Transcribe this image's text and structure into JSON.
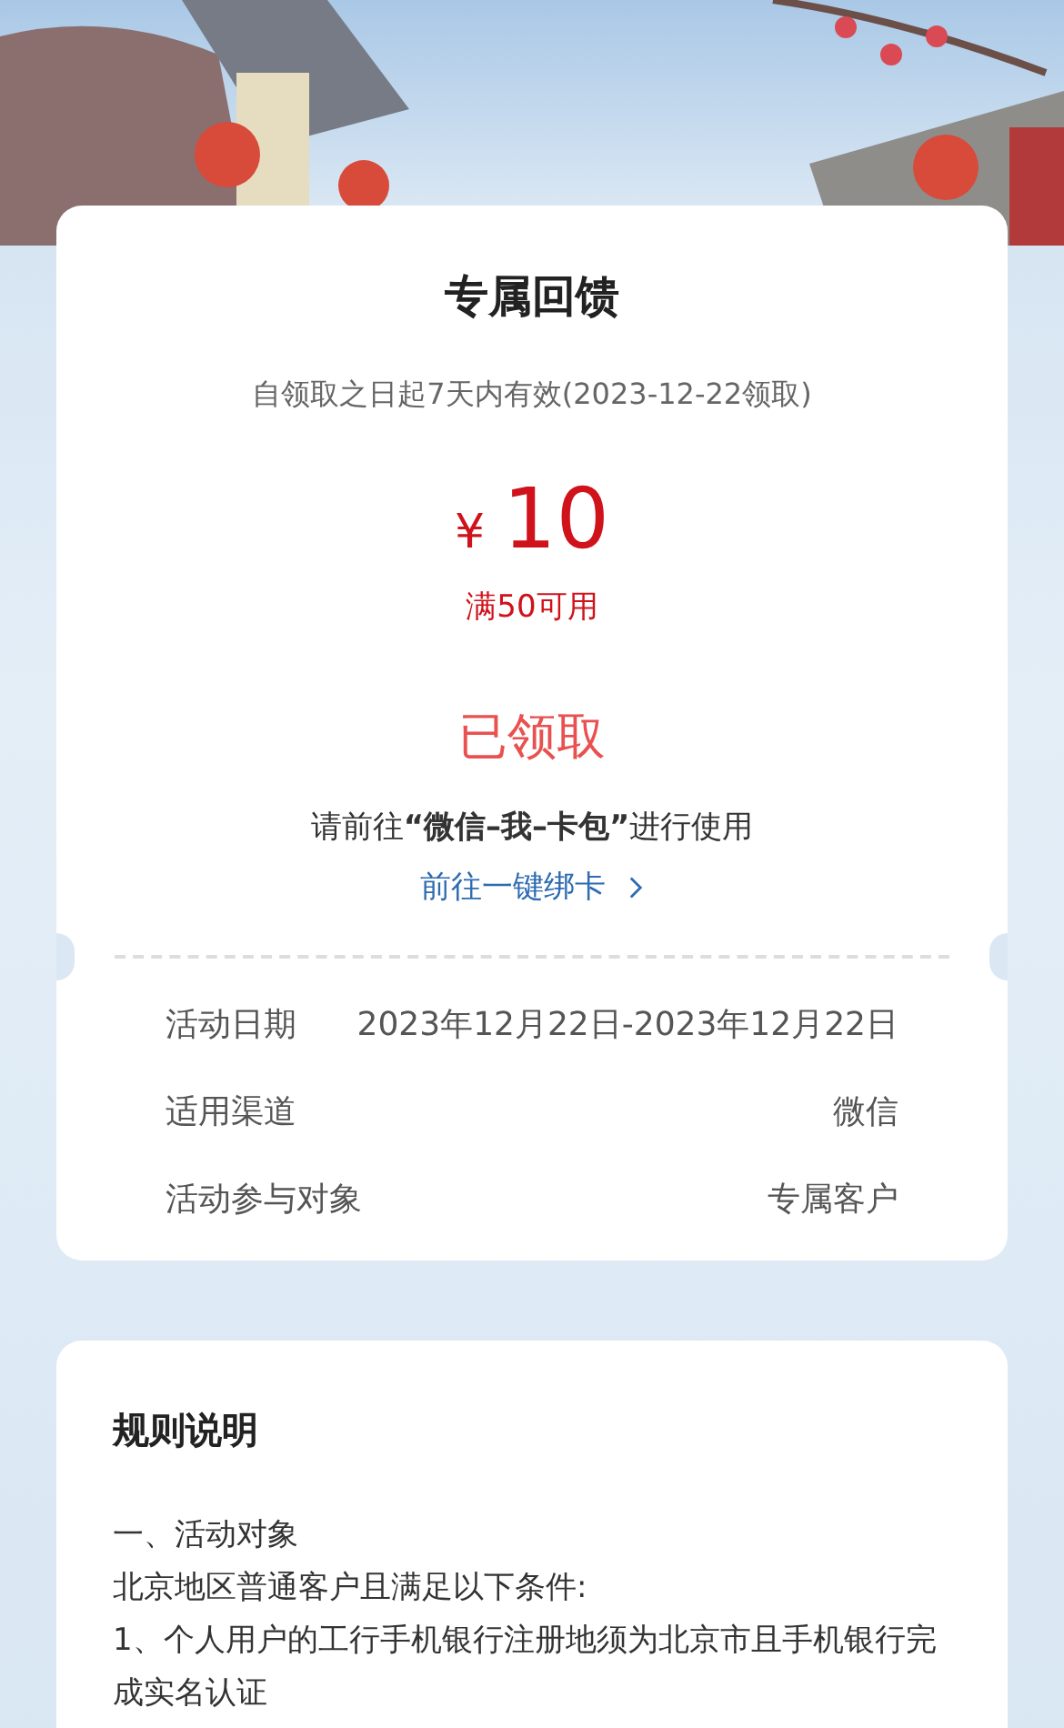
{
  "coupon": {
    "title": "专属回馈",
    "validity": "自领取之日起7天内有效(2023-12-22领取)",
    "currency": "¥",
    "amount": "10",
    "condition": "满50可用",
    "status": "已领取",
    "instruction": "请前往**“微信–我–卡包”**进行使用",
    "link": "前往一键绑卡",
    "details": [
      {
        "label": "活动日期",
        "value": "2023年12月22日-2023年12月22日"
      },
      {
        "label": "适用渠道",
        "value": "微信"
      },
      {
        "label": "活动参与对象",
        "value": "专属客户"
      }
    ]
  },
  "rules": {
    "title": "规则说明",
    "paragraphs": [
      "一、活动对象",
      "北京地区普通客户且满足以下条件:",
      "1、个人用户的工行手机银行注册地须为北京市且手机银行完成实名认证"
    ]
  }
}
